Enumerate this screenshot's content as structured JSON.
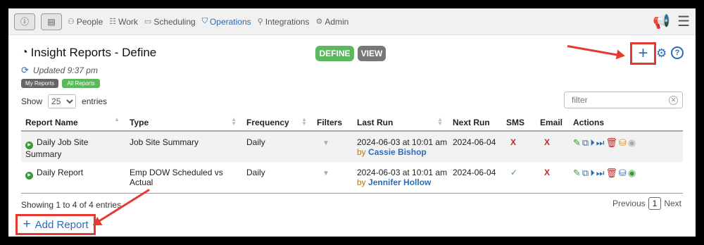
{
  "nav": {
    "items": [
      {
        "label": "People",
        "icon": "person-icon"
      },
      {
        "label": "Work",
        "icon": "work-icon"
      },
      {
        "label": "Scheduling",
        "icon": "calendar-icon"
      },
      {
        "label": "Operations",
        "icon": "shield-icon"
      },
      {
        "label": "Integrations",
        "icon": "plug-icon"
      },
      {
        "label": "Admin",
        "icon": "gear-icon"
      }
    ],
    "active": "Operations"
  },
  "header": {
    "title": "Insight Reports - Define",
    "updated": "Updated 9:37 pm",
    "define_label": "DEFINE",
    "view_label": "VIEW",
    "chip_my": "My Reports",
    "chip_all": "All Reports"
  },
  "controls": {
    "show_label": "Show",
    "entries_value": "25",
    "entries_label": "entries",
    "filter_placeholder": "filter"
  },
  "table": {
    "headers": [
      "Report Name",
      "Type",
      "Frequency",
      "Filters",
      "Last Run",
      "Next Run",
      "SMS",
      "Email",
      "Actions"
    ],
    "rows": [
      {
        "name": "Daily Job Site Summary",
        "type": "Job Site Summary",
        "frequency": "Daily",
        "last_run": "2024-06-03 at 10:01 am",
        "by_prefix": "by",
        "by_name": "Cassie Bishop",
        "next_run": "2024-06-04",
        "sms": "X",
        "email": "X"
      },
      {
        "name": "Daily Report",
        "type": "Emp DOW Scheduled vs Actual",
        "frequency": "Daily",
        "last_run": "2024-06-03 at 10:01 am",
        "by_prefix": "by",
        "by_name": "Jennifer Hollow",
        "next_run": "2024-06-04",
        "sms": "✓",
        "email": "X"
      }
    ]
  },
  "footer": {
    "showing": "Showing 1 to 4 of 4 entries",
    "previous": "Previous",
    "page": "1",
    "next": "Next",
    "add_report": "Add Report"
  },
  "colors": {
    "accent": "#2a6cb6",
    "define": "#5cb85c",
    "view": "#777777",
    "annotation": "#e53a32"
  }
}
